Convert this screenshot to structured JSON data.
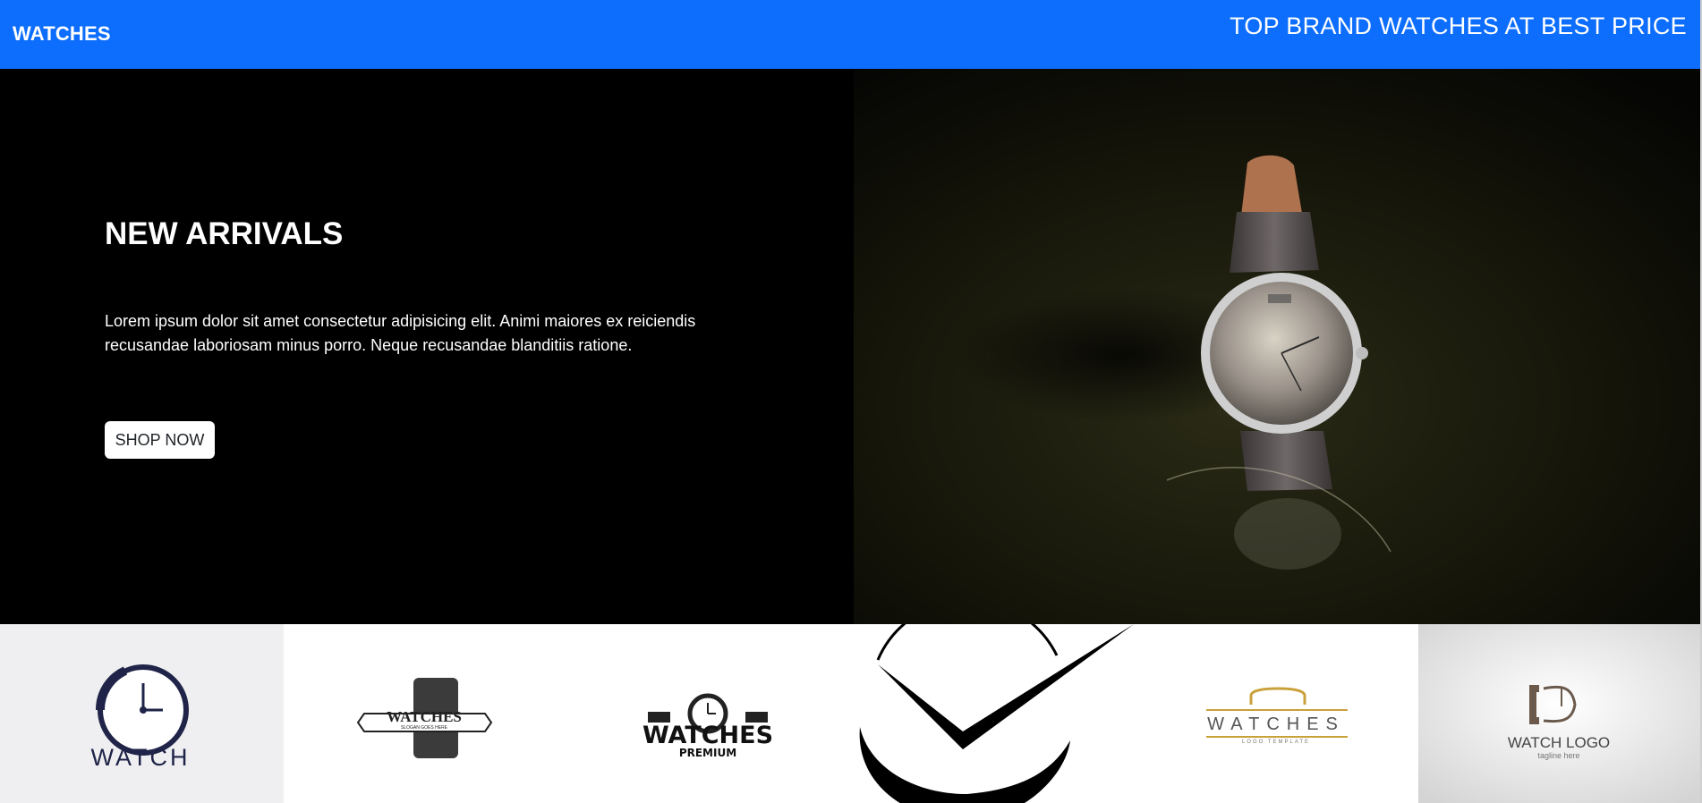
{
  "navbar": {
    "brand": "WATCHES",
    "tagline": "TOP BRAND WATCHES AT BEST PRICE",
    "background_color": "#0d6efd"
  },
  "hero": {
    "title": "NEW ARRIVALS",
    "description": "Lorem ipsum dolor sit amet consectetur adipisicing elit. Animi maiores ex reiciendis recusandae laboriosam minus porro. Neque recusandae blanditiis ratione.",
    "button_label": "SHOP NOW",
    "image_icon": "wristwatch-photo"
  },
  "logos": [
    {
      "icon": "watch-logo-clock",
      "text": "WATCH"
    },
    {
      "icon": "watches-badge-logo",
      "text": "WATCHES",
      "subtext": "SLOGAN GOES HERE"
    },
    {
      "icon": "watches-premium-logo",
      "text": "WATCHES",
      "subtext": "PREMIUM"
    },
    {
      "icon": "check-clock-logo"
    },
    {
      "icon": "watches-gold-logo",
      "text": "WATCHES",
      "subtext": "LOGO TEMPLATE"
    },
    {
      "icon": "watch-logo-tagline",
      "text": "WATCH LOGO",
      "subtext": "tagline here"
    }
  ]
}
